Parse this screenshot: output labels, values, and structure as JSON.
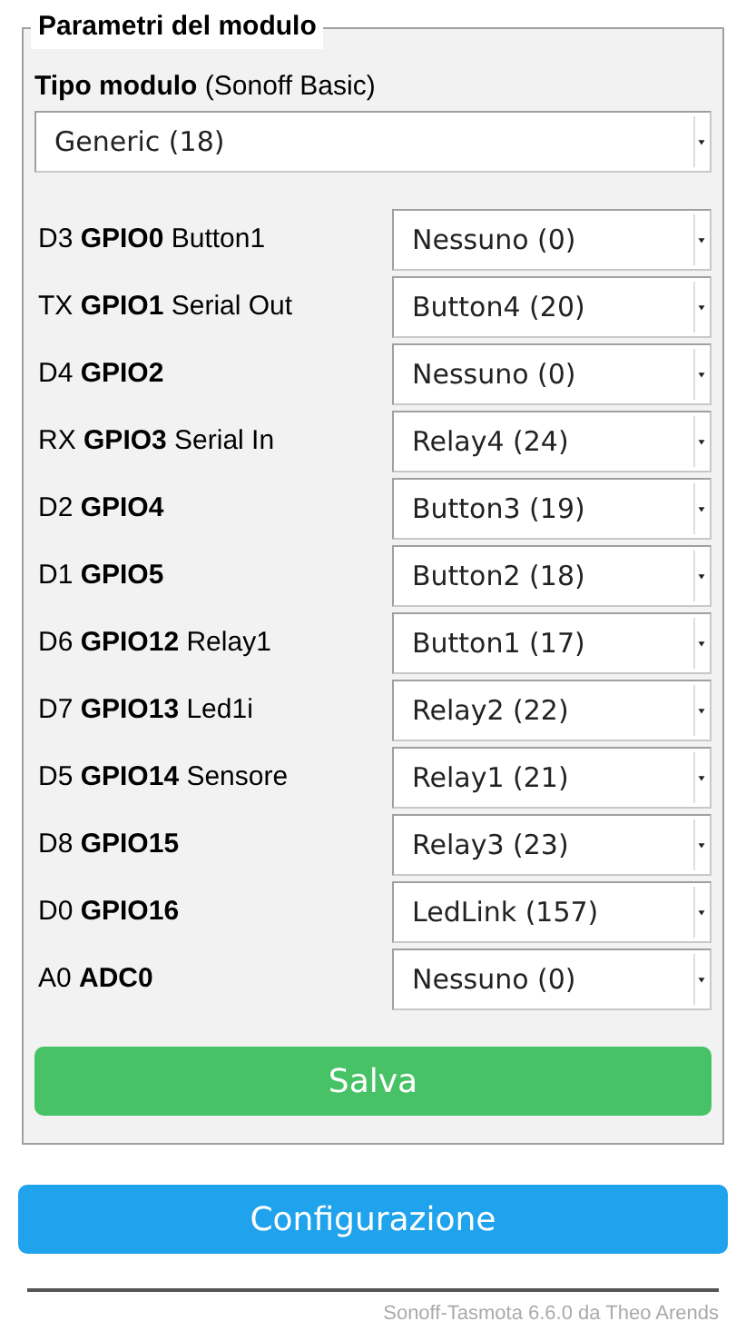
{
  "legend": "Parametri del modulo",
  "module_type": {
    "label": "Tipo modulo",
    "current": "(Sonoff Basic)",
    "value": "Generic (18)"
  },
  "gpios": [
    {
      "label": "D3 **GPIO0** Button1",
      "value": "Nessuno (0)"
    },
    {
      "label": "TX **GPIO1** Serial Out",
      "value": "Button4 (20)"
    },
    {
      "label": "D4 **GPIO2**",
      "value": "Nessuno (0)"
    },
    {
      "label": "RX **GPIO3** Serial In",
      "value": "Relay4 (24)"
    },
    {
      "label": "D2 **GPIO4**",
      "value": "Button3 (19)"
    },
    {
      "label": "D1 **GPIO5**",
      "value": "Button2 (18)"
    },
    {
      "label": "D6 **GPIO12** Relay1",
      "value": "Button1 (17)"
    },
    {
      "label": "D7 **GPIO13** Led1i",
      "value": "Relay2 (22)"
    },
    {
      "label": "D5 **GPIO14** Sensore",
      "value": "Relay1 (21)"
    },
    {
      "label": "D8 **GPIO15**",
      "value": "Relay3 (23)"
    },
    {
      "label": "D0 **GPIO16**",
      "value": "LedLink (157)"
    },
    {
      "label": "A0 **ADC0**",
      "value": "Nessuno (0)"
    }
  ],
  "save_button": "Salva",
  "config_button": "Configurazione",
  "footer": "Sonoff-Tasmota 6.6.0 da Theo Arends"
}
